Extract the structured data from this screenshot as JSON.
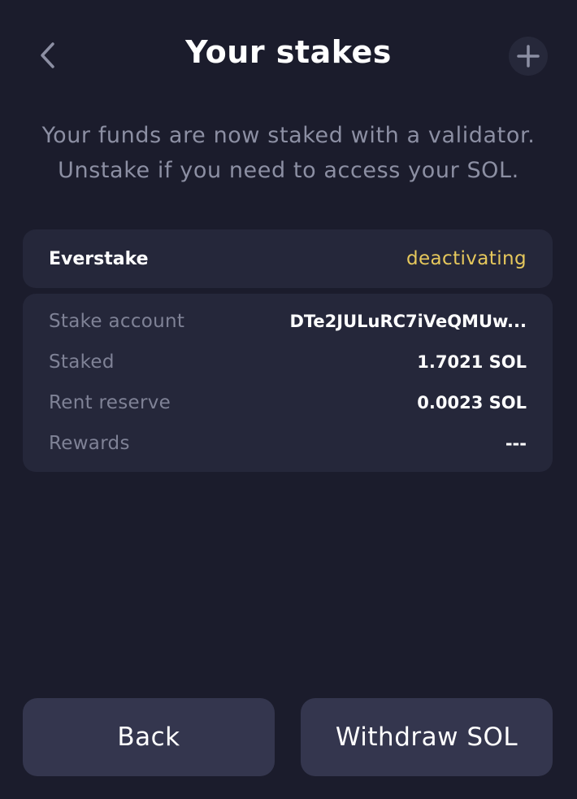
{
  "header": {
    "title": "Your stakes",
    "back_icon": "chevron-left-icon",
    "add_icon": "plus-icon"
  },
  "subtitle": {
    "line1": "Your funds are now staked with a validator.",
    "line2": "Unstake if you need to access your SOL."
  },
  "validator": {
    "name": "Everstake",
    "status": "deactivating",
    "status_color": "#e6c85c"
  },
  "details": [
    {
      "label": "Stake account",
      "value": "DTe2JULuRC7iVeQMUw..."
    },
    {
      "label": "Staked",
      "value": "1.7021 SOL"
    },
    {
      "label": "Rent reserve",
      "value": "0.0023 SOL"
    },
    {
      "label": "Rewards",
      "value": "---"
    }
  ],
  "buttons": {
    "back_label": "Back",
    "withdraw_label": "Withdraw SOL"
  },
  "colors": {
    "background": "#1b1c2c",
    "card": "#25273a",
    "button": "#34364e",
    "muted_text": "#8c8fa3"
  }
}
